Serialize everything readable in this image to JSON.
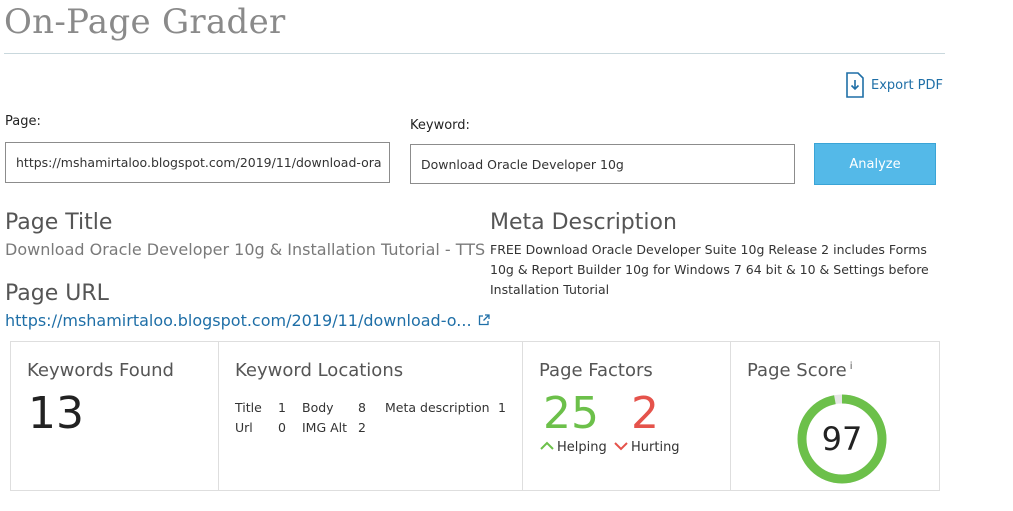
{
  "header": {
    "title": "On-Page Grader"
  },
  "export": {
    "label": "Export PDF",
    "icon": "pdf-download-icon"
  },
  "form": {
    "page_label": "Page:",
    "page_value": "https://mshamirtaloo.blogspot.com/2019/11/download-ora",
    "keyword_label": "Keyword:",
    "keyword_value": "Download Oracle Developer 10g",
    "analyze_label": "Analyze"
  },
  "page_title": {
    "heading": "Page Title",
    "value": "Download Oracle Developer 10g & Installation Tutorial - TTS"
  },
  "page_url": {
    "heading": "Page URL",
    "value": "https://mshamirtaloo.blogspot.com/2019/11/download-o...",
    "icon": "external-link-icon"
  },
  "meta": {
    "heading": "Meta Description",
    "value": "FREE Download Oracle Developer Suite 10g Release 2 includes Forms 10g & Report Builder 10g for Windows 7 64 bit & 10 & Settings before Installation Tutorial"
  },
  "stats": {
    "keywords_found": {
      "heading": "Keywords Found",
      "value": "13"
    },
    "keyword_locations": {
      "heading": "Keyword Locations",
      "rows": [
        [
          {
            "label": "Title",
            "value": "1"
          },
          {
            "label": "Body",
            "value": "8"
          },
          {
            "label": "Meta description",
            "value": "1"
          }
        ],
        [
          {
            "label": "Url",
            "value": "0"
          },
          {
            "label": "IMG Alt",
            "value": "2"
          }
        ]
      ]
    },
    "page_factors": {
      "heading": "Page Factors",
      "helping_value": "25",
      "helping_label": "Helping",
      "hurting_value": "2",
      "hurting_label": "Hurting"
    },
    "page_score": {
      "heading": "Page Score",
      "info": "i",
      "value": "97",
      "fraction": 0.97
    }
  },
  "colors": {
    "accent": "#54b9e8",
    "link": "#1f6fa7",
    "helping": "#6cc04a",
    "hurting": "#e5534b",
    "score_ring": "#6cc04a"
  }
}
